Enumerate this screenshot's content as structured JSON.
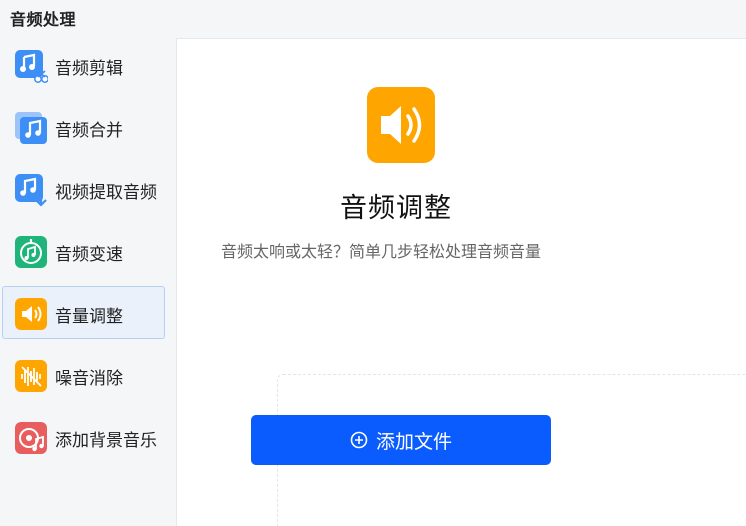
{
  "header": {
    "section_title": "音频处理"
  },
  "sidebar": {
    "items": [
      {
        "label": "音频剪辑",
        "icon": "audio-cut-icon",
        "color": "#3d8ff6",
        "active": false
      },
      {
        "label": "音频合并",
        "icon": "audio-merge-icon",
        "color": "#3d8ff6",
        "active": false
      },
      {
        "label": "视频提取音频",
        "icon": "extract-audio-icon",
        "color": "#3d8ff6",
        "active": false
      },
      {
        "label": "音频变速",
        "icon": "audio-speed-icon",
        "color": "#1fb57a",
        "active": false
      },
      {
        "label": "音量调整",
        "icon": "volume-icon",
        "color": "#ffa500",
        "active": true
      },
      {
        "label": "噪音消除",
        "icon": "noise-remove-icon",
        "color": "#ffa500",
        "active": false
      },
      {
        "label": "添加背景音乐",
        "icon": "background-music-icon",
        "color": "#e85d5d",
        "active": false
      }
    ]
  },
  "main": {
    "title": "音频调整",
    "subtitle": "音频太响或太轻？简单几步轻松处理音频音量",
    "hero_icon": "volume-icon",
    "hero_color": "#ffa500",
    "add_button_label": "添加文件",
    "add_button_color": "#0b5cff"
  }
}
